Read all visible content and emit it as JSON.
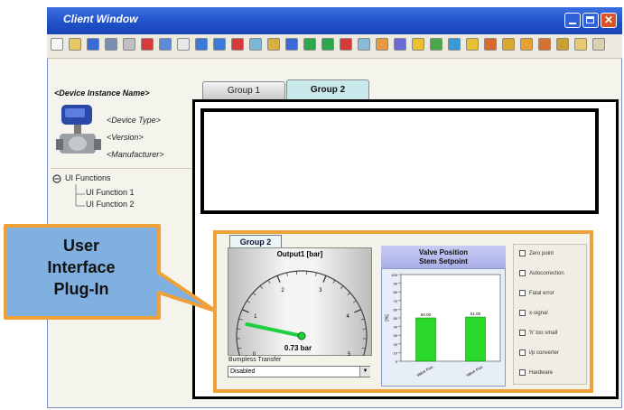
{
  "window": {
    "title": "Client Window",
    "close_glyph": "✕"
  },
  "toolbar": {
    "icon_count": 31
  },
  "device": {
    "instance_name": "<Device Instance Name>",
    "type": "<Device Type>",
    "version": "<Version>",
    "manufacturer": "<Manufacturer>"
  },
  "tree": {
    "root": "UI Functions",
    "items": [
      "UI Function 1",
      "UI Function 2"
    ]
  },
  "tabs": [
    {
      "label": "Group 1",
      "active": false
    },
    {
      "label": "Group 2",
      "active": true
    }
  ],
  "plugin": {
    "group_tab": "Group 2",
    "gauge": {
      "title": "Output1 [bar]",
      "reading": "0.73 bar",
      "ticks": [
        "0",
        "1",
        "2",
        "3",
        "4",
        "5"
      ],
      "value": 0.73,
      "max": 5
    },
    "bumpless_label": "Bumpless Transfer",
    "select_value": "Disabled",
    "chart_title_line1": "Valve Position",
    "chart_title_line2": "Stem Setpoint",
    "checks": [
      "Zero point",
      "Autocorrection",
      "Fatal error",
      "x-signal",
      "'h' too small",
      "i/p converter",
      "Hardware"
    ]
  },
  "callout": {
    "line1": "User",
    "line2": "Interface",
    "line3": "Plug-In"
  },
  "colors": {
    "accent": "#f0a038",
    "title_bar": "#1f4fc8",
    "gauge_needle": "#1ed040",
    "bars": "#2ad82a"
  },
  "chart_data": {
    "type": "bar",
    "title": "Valve Position Stem Setpoint",
    "categories": [
      "Valve Pos.",
      "Valve Pos."
    ],
    "values": [
      50.0,
      51.0
    ],
    "data_labels": [
      "50.00",
      "51.00"
    ],
    "ylim": [
      0,
      100
    ],
    "ylabel": "[%]",
    "yticks": [
      "0",
      "10",
      "20",
      "30",
      "40",
      "50",
      "60",
      "70",
      "80",
      "90",
      "100"
    ],
    "grid": false
  }
}
